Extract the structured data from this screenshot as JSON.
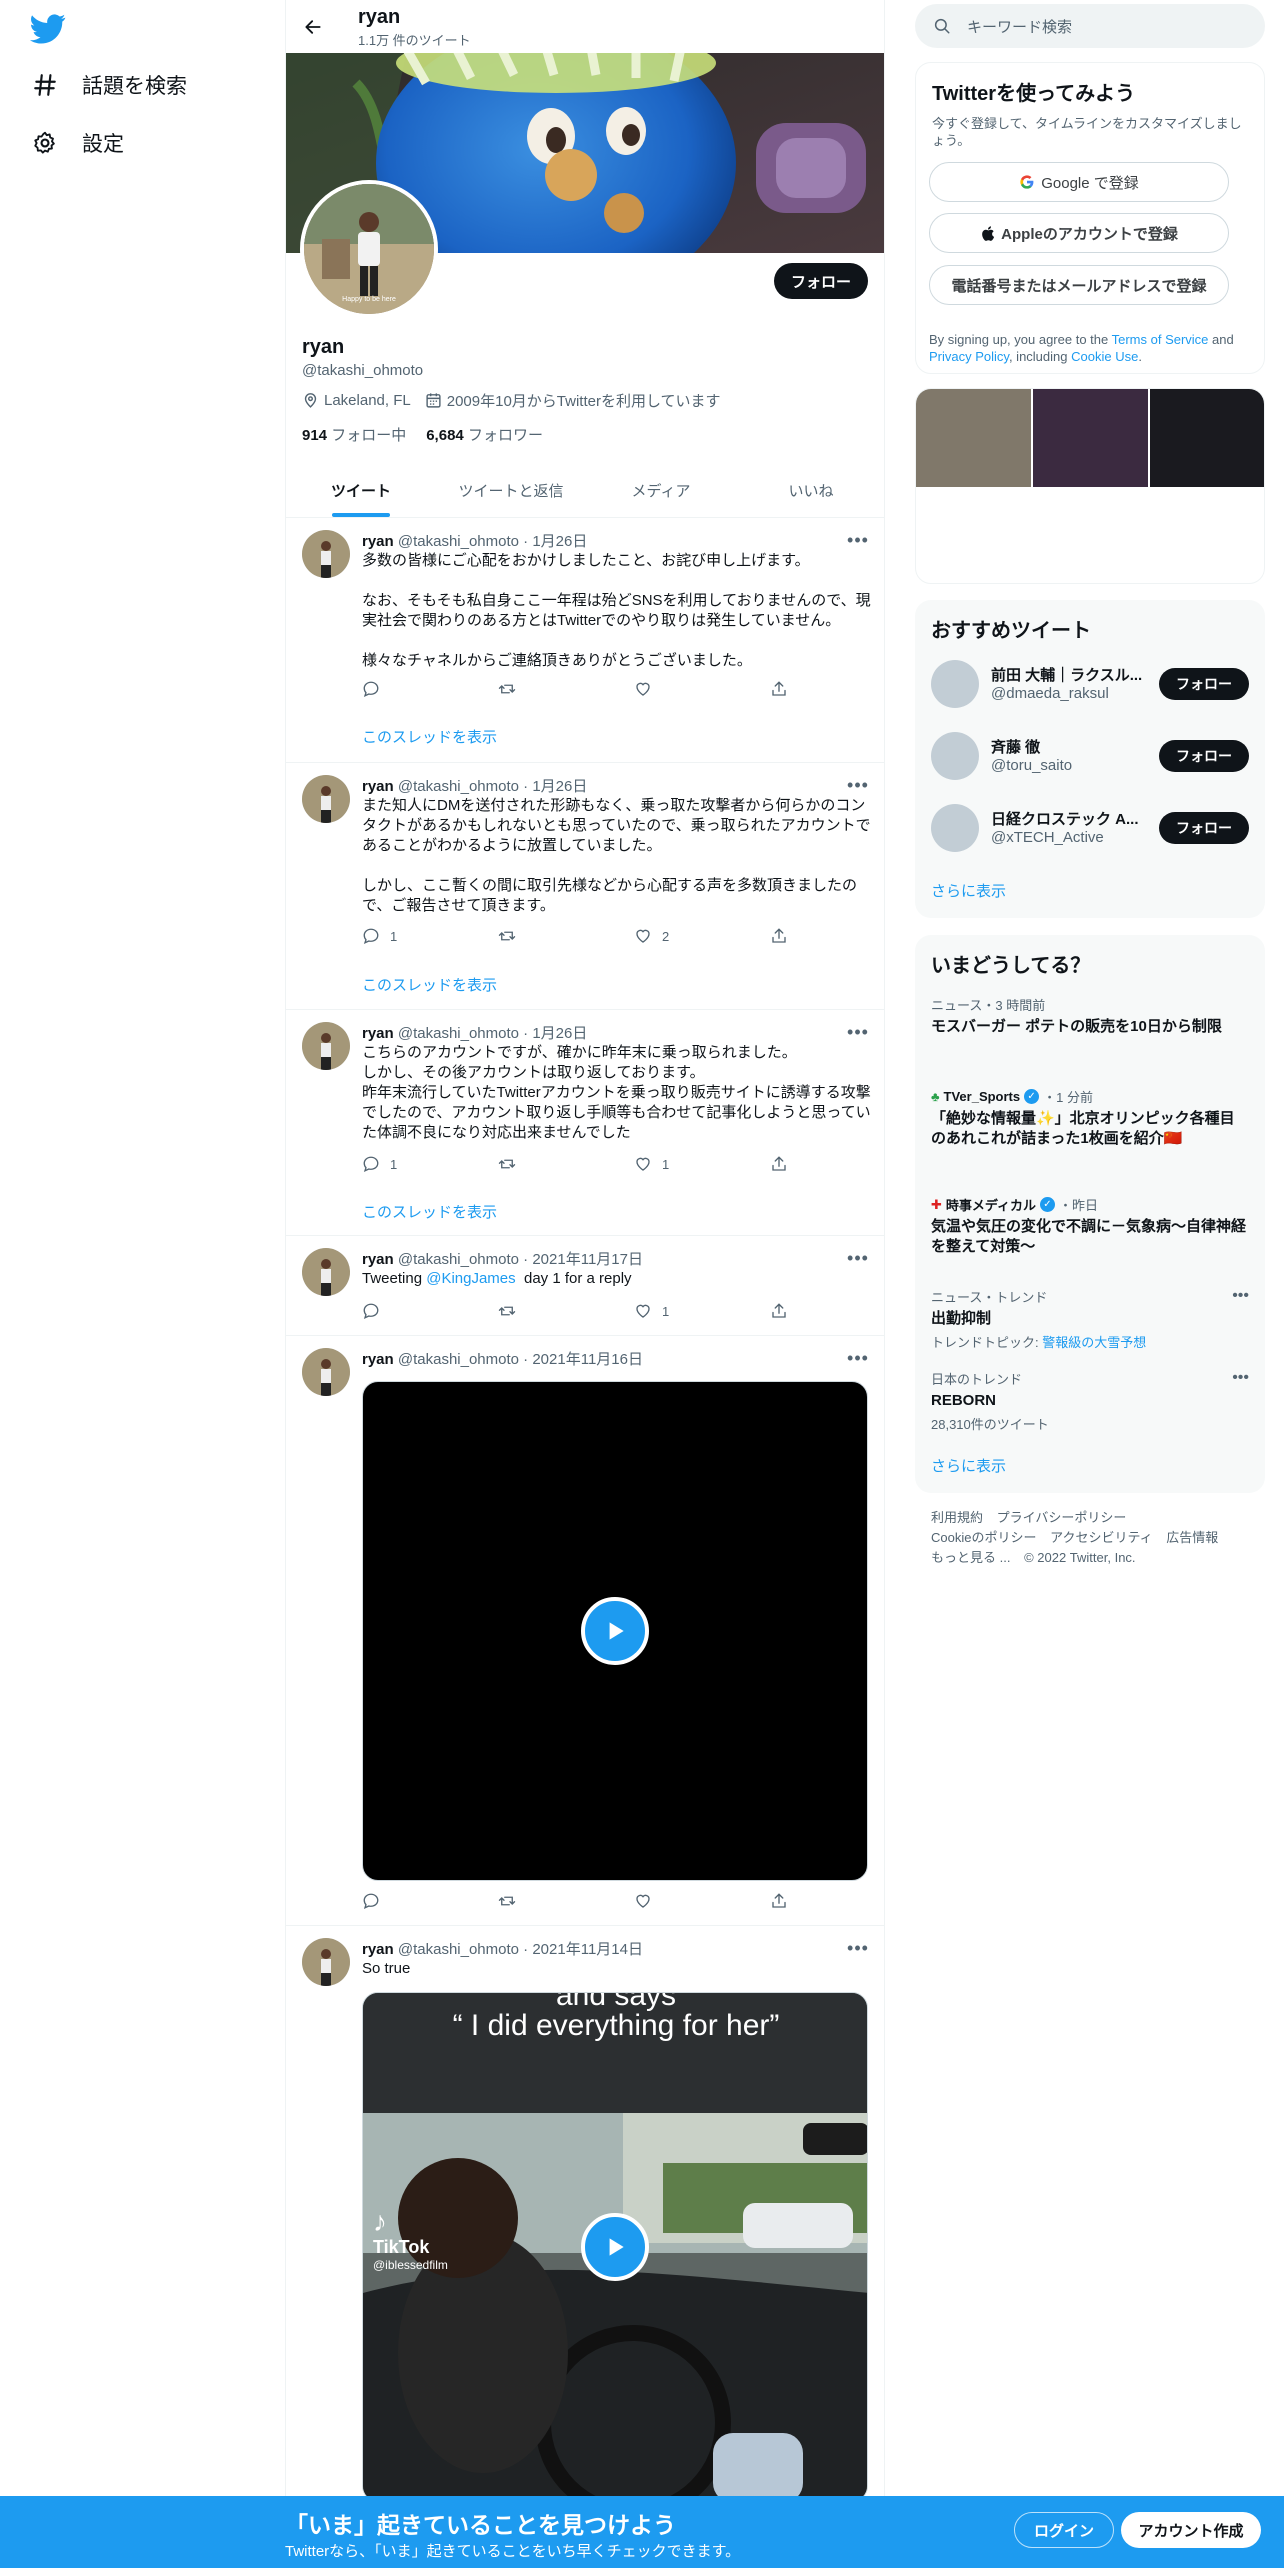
{
  "nav": {
    "explore_label": "話題を検索",
    "settings_label": "設定"
  },
  "header": {
    "name": "ryan",
    "tweet_count": "1.1万 件のツイート"
  },
  "profile": {
    "follow_label": "フォロー",
    "name": "ryan",
    "handle": "@takashi_ohmoto",
    "location": "Lakeland, FL",
    "joined": "2009年10月からTwitterを利用しています",
    "following_count": "914",
    "following_label": "フォロー中",
    "followers_count": "6,684",
    "followers_label": "フォロワー",
    "avatar_caption": "Happy to be here"
  },
  "tabs": [
    "ツイート",
    "ツイートと返信",
    "メディア",
    "いいね"
  ],
  "tweets": [
    {
      "name": "ryan",
      "handle": "@takashi_ohmoto",
      "date": "1月26日",
      "text": "多数の皆様にご心配をおかけしましたこと、お詫び申し上げます。\n\nなお、そもそも私自身ここ一年程は殆どSNSを利用しておりませんので、現実社会で関わりのある方とはTwitterでのやり取りは発生していません。\n\n様々なチャネルからご連絡頂きありがとうございました。",
      "reply": "",
      "retweet": "",
      "like": "",
      "thread": "このスレッドを表示"
    },
    {
      "name": "ryan",
      "handle": "@takashi_ohmoto",
      "date": "1月26日",
      "text": "また知人にDMを送付された形跡もなく、乗っ取た攻撃者から何らかのコンタクトがあるかもしれないとも思っていたので、乗っ取られたアカウントであることがわかるように放置していました。\n\nしかし、ここ暫くの間に取引先様などから心配する声を多数頂きましたので、ご報告させて頂きます。",
      "reply": "1",
      "retweet": "",
      "like": "2",
      "thread": "このスレッドを表示"
    },
    {
      "name": "ryan",
      "handle": "@takashi_ohmoto",
      "date": "1月26日",
      "text": "こちらのアカウントですが、確かに昨年末に乗っ取られました。\nしかし、その後アカウントは取り返しております。\n昨年末流行していたTwitterアカウントを乗っ取り販売サイトに誘導する攻撃でしたので、アカウント取り返し手順等も合わせて記事化しようと思っていた体調不良になり対応出来ませんでした",
      "reply": "1",
      "retweet": "",
      "like": "1",
      "thread": "このスレッドを表示"
    },
    {
      "name": "ryan",
      "handle": "@takashi_ohmoto",
      "date": "2021年11月17日",
      "text_pre": "Tweeting ",
      "mention": "@KingJames",
      "text_post": "  day 1 for a reply",
      "reply": "",
      "retweet": "",
      "like": "1"
    },
    {
      "name": "ryan",
      "handle": "@takashi_ohmoto",
      "date": "2021年11月16日",
      "reply": "",
      "retweet": "",
      "like": ""
    },
    {
      "name": "ryan",
      "handle": "@takashi_ohmoto",
      "date": "2021年11月14日",
      "text": "So true",
      "video_caption_top": "and says",
      "video_caption": "“ I did everything for her”",
      "video_brand": "TikTok",
      "video_user": "@iblessedfilm"
    }
  ],
  "sidebar": {
    "search_placeholder": "キーワード検索",
    "signup": {
      "title": "Twitterを使ってみよう",
      "sub": "今すぐ登録して、タイムラインをカスタマイズしましょう。",
      "google": "Google で登録",
      "apple": "Appleのアカウントで登録",
      "phone": "電話番号またはメールアドレスで登録",
      "legal_pre": "By signing up, you agree to the ",
      "terms": "Terms of Service",
      "and": " and ",
      "privacy": "Privacy Policy",
      "including": ", including ",
      "cookie": "Cookie Use",
      "period": "."
    },
    "who": {
      "title": "おすすめツイート",
      "items": [
        {
          "name": "前田 大輔｜ラクスル...",
          "handle": "@dmaeda_raksul",
          "btn": "フォロー"
        },
        {
          "name": "斉藤 徹",
          "handle": "@toru_saito",
          "btn": "フォロー"
        },
        {
          "name": "日経クロステック A...",
          "handle": "@xTECH_Active",
          "btn": "フォロー"
        }
      ],
      "show_more": "さらに表示"
    },
    "trends": {
      "title": "いまどうしてる？",
      "items": [
        {
          "meta": "ニュース・3 時間前",
          "title": "モスバーガー ポテトの販売を10日から制限"
        },
        {
          "meta_name": "TVer_Sports",
          "meta_time": "・1 分前",
          "title": "「絶妙な情報量✨」北京オリンピック各種目のあれこれが詰まった1枚画を紹介🇨🇳"
        },
        {
          "meta_name": "時事メディカル",
          "meta_time": "・昨日",
          "title": "気温や気圧の変化で不調に－気象病～自律神経を整えて対策～"
        },
        {
          "meta": "ニュース・トレンド",
          "title": "出勤抑制",
          "sub_pre": "トレンドトピック: ",
          "sub_link": "警報級の大雪予想"
        },
        {
          "meta": "日本のトレンド",
          "title": "REBORN",
          "sub": "28,310件のツイート"
        }
      ],
      "show_more": "さらに表示"
    },
    "footer": [
      "利用規約",
      "プライバシーポリシー",
      "Cookieのポリシー",
      "アクセシビリティ",
      "広告情報",
      "もっと見る ...",
      "© 2022 Twitter, Inc."
    ]
  },
  "bottom": {
    "title": "「いま」起きていることを見つけよう",
    "sub": "Twitterなら、「いま」起きていることをいち早くチェックできます。",
    "login": "ログイン",
    "signup": "アカウント作成"
  },
  "colors": {
    "accent": "#1d9bf0",
    "text": "#0f1419",
    "muted": "#536471"
  }
}
